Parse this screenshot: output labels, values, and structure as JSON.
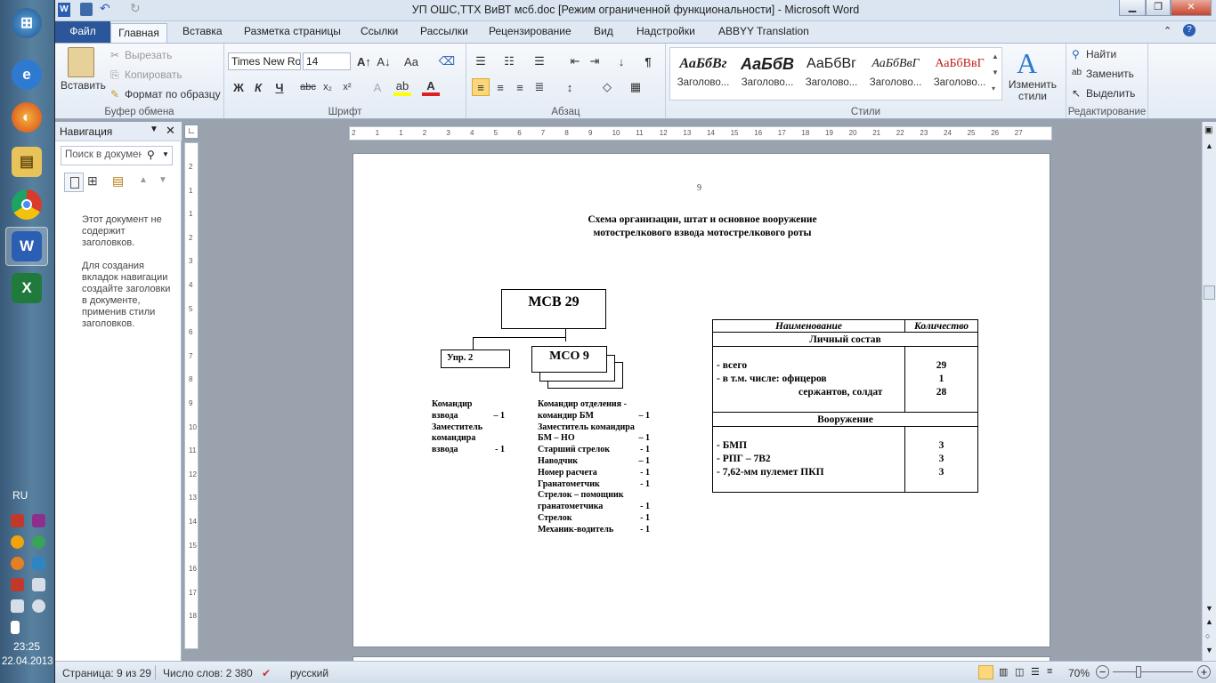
{
  "window": {
    "title": "УП ОШС,ТТХ ВиВТ мсб.doc [Режим ограниченной функциональности]  -  Microsoft Word"
  },
  "tabs": [
    "Файл",
    "Главная",
    "Вставка",
    "Разметка страницы",
    "Ссылки",
    "Рассылки",
    "Рецензирование",
    "Вид",
    "Надстройки",
    "ABBYY Translation"
  ],
  "ribbon": {
    "clipboard": {
      "paste": "Вставить",
      "cut": "Вырезать",
      "copy": "Копировать",
      "format_painter": "Формат по образцу",
      "label": "Буфер обмена"
    },
    "font": {
      "name": "Times New Ro",
      "size": "14",
      "label": "Шрифт",
      "bold": "Ж",
      "italic": "К",
      "underline": "Ч",
      "strike": "abc"
    },
    "paragraph": {
      "label": "Абзац"
    },
    "styles": {
      "label": "Стили",
      "samples": [
        "АаБбВг",
        "АаБбВ",
        "АаБбВг",
        "АаБбВвГ",
        "АаБбВвГ"
      ],
      "names": [
        "Заголово...",
        "Заголово...",
        "Заголово...",
        "Заголово...",
        "Заголово..."
      ],
      "change": "Изменить стили"
    },
    "editing": {
      "label": "Редактирование",
      "find": "Найти",
      "replace": "Заменить",
      "select": "Выделить"
    }
  },
  "nav": {
    "title": "Навигация",
    "search_placeholder": "Поиск в документе",
    "msg1": "Этот документ не содержит заголовков.",
    "msg2": "Для создания вкладок навигации создайте заголовки в документе, применив стили заголовков."
  },
  "doc": {
    "page_number": "9",
    "title1": "Схема организации, штат и основное вооружение",
    "title2": "мотострелкового взвода мотострелкового роты",
    "msv": "МСВ 29",
    "upr": "Упр.    2",
    "mso": "МСО 9",
    "left_list": [
      {
        "t": "  Командир",
        "v": ""
      },
      {
        "t": "взвода",
        "v": "– 1"
      },
      {
        "t": "Заместитель",
        "v": ""
      },
      {
        "t": "командира",
        "v": ""
      },
      {
        "t": "взвода",
        "v": "- 1"
      }
    ],
    "right_list": [
      {
        "t": "  Командир отделения -",
        "v": ""
      },
      {
        "t": "командир БМ",
        "v": "– 1"
      },
      {
        "t": "Заместитель командира",
        "v": ""
      },
      {
        "t": "БМ – НО",
        "v": "– 1"
      },
      {
        "t": "Старший стрелок",
        "v": "- 1"
      },
      {
        "t": "Наводчик",
        "v": "– 1"
      },
      {
        "t": "Номер расчета",
        "v": "- 1"
      },
      {
        "t": "Гранатометчик",
        "v": "- 1"
      },
      {
        "t": "Стрелок – помощник",
        "v": ""
      },
      {
        "t": "гранатометчика",
        "v": "- 1"
      },
      {
        "t": "Стрелок",
        "v": "- 1"
      },
      {
        "t": "Механик-водитель",
        "v": "- 1"
      }
    ],
    "table": {
      "h_name": "Наименование",
      "h_qty": "Количество",
      "sec1": "Личный состав",
      "r1": "- всего",
      "r2": "- в т.м. числе:    офицеров",
      "r3": "сержантов, солдат",
      "v1": "29",
      "v2": "1",
      "v3": "28",
      "sec2": "Вооружение",
      "w1": "- БМП",
      "w2": "- РПГ – 7В2",
      "w3": "- 7,62-мм пулемет ПКП",
      "wv1": "3",
      "wv2": "3",
      "wv3": "3"
    }
  },
  "status": {
    "page": "Страница: 9 из 29",
    "words": "Число слов: 2 380",
    "lang": "русский",
    "zoom": "70%"
  },
  "taskbar": {
    "lang": "RU",
    "time": "23:25",
    "date": "22.04.2013"
  },
  "hruler_ticks": [
    "2",
    "1",
    "1",
    "2",
    "3",
    "4",
    "5",
    "6",
    "7",
    "8",
    "9",
    "10",
    "11",
    "12",
    "13",
    "14",
    "15",
    "16",
    "17",
    "18",
    "19",
    "20",
    "21",
    "22",
    "23",
    "24",
    "25",
    "26",
    "27"
  ],
  "vruler_ticks": [
    "2",
    "1",
    "1",
    "2",
    "3",
    "4",
    "5",
    "6",
    "7",
    "8",
    "9",
    "10",
    "11",
    "12",
    "13",
    "14",
    "15",
    "16",
    "17",
    "18"
  ]
}
